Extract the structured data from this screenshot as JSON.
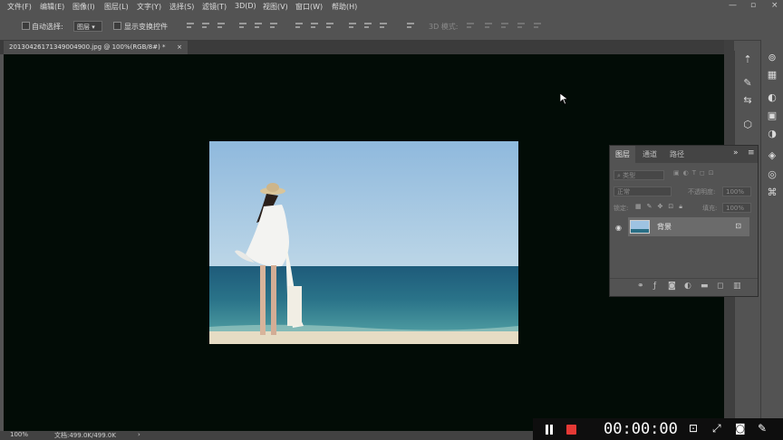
{
  "menu": [
    "文件(F)",
    "编辑(E)",
    "图像(I)",
    "图层(L)",
    "文字(Y)",
    "选择(S)",
    "滤镜(T)",
    "3D(D)",
    "视图(V)",
    "窗口(W)",
    "帮助(H)"
  ],
  "window_controls": {
    "minimize": "—",
    "restore": "▫",
    "close": "×"
  },
  "options": {
    "auto_select_label": "自动选择:",
    "auto_select_target": "图层",
    "show_transform_label": "显示变换控件",
    "mode_3d_label": "3D 模式:"
  },
  "document_tab": {
    "title": "20130426171349004900.jpg @ 100%(RGB/8#) *",
    "close": "×"
  },
  "status": {
    "zoom": "100%",
    "doc_size": "文档:499.0K/499.0K",
    "arrow": "›"
  },
  "layers_panel": {
    "tabs": [
      "图层",
      "通道",
      "路径"
    ],
    "collapse": "»",
    "menu": "≡",
    "filter_placeholder": "类型",
    "blend_mode": "正常",
    "opacity_label": "不透明度:",
    "opacity_value": "100%",
    "lock_label": "锁定:",
    "fill_label": "填充:",
    "fill_value": "100%",
    "layer_name": "背景"
  },
  "recorder": {
    "time": "00:00:00"
  }
}
